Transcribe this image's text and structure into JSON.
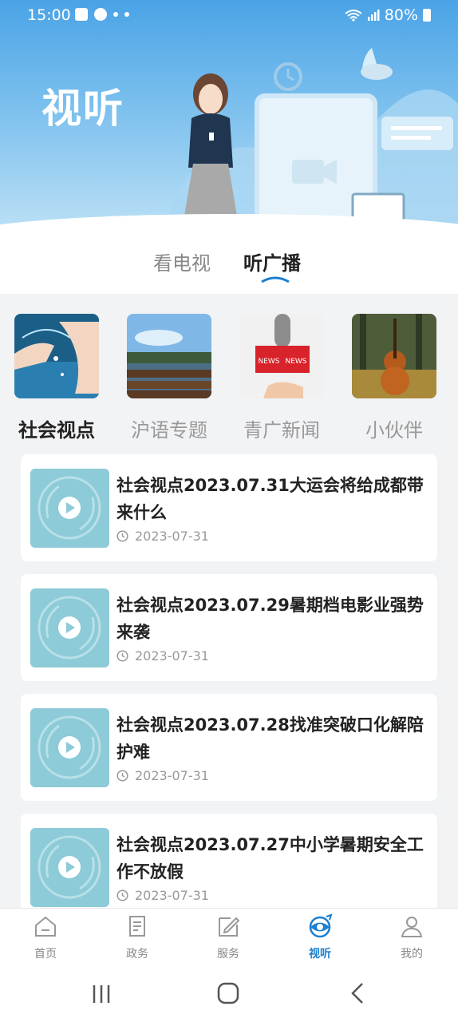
{
  "status_bar": {
    "time": "15:00",
    "battery": "80%"
  },
  "header": {
    "title": "视听"
  },
  "media_tabs": [
    {
      "label": "看电视",
      "active": false
    },
    {
      "label": "听广播",
      "active": true
    }
  ],
  "categories": [
    {
      "label": "社会视点",
      "active": true
    },
    {
      "label": "沪语专题",
      "active": false
    },
    {
      "label": "青广新闻",
      "active": false
    },
    {
      "label": "小伙伴",
      "active": false
    }
  ],
  "news_thumb_text": "NEWS",
  "items": [
    {
      "title": "社会视点2023.07.31大运会将给成都带来什么",
      "date": "2023-07-31"
    },
    {
      "title": "社会视点2023.07.29暑期档电影业强势来袭",
      "date": "2023-07-31"
    },
    {
      "title": "社会视点2023.07.28找准突破口化解陪护难",
      "date": "2023-07-31"
    },
    {
      "title": "社会视点2023.07.27中小学暑期安全工作不放假",
      "date": "2023-07-31"
    }
  ],
  "nav": [
    {
      "label": "首页",
      "icon": "home-icon"
    },
    {
      "label": "政务",
      "icon": "document-icon"
    },
    {
      "label": "服务",
      "icon": "edit-icon"
    },
    {
      "label": "视听",
      "icon": "eye-icon",
      "active": true
    },
    {
      "label": "我的",
      "icon": "user-icon"
    }
  ],
  "colors": {
    "accent": "#1a7fd0",
    "header_top": "#4aa3e6",
    "thumb_bg": "#8ccbd7"
  }
}
